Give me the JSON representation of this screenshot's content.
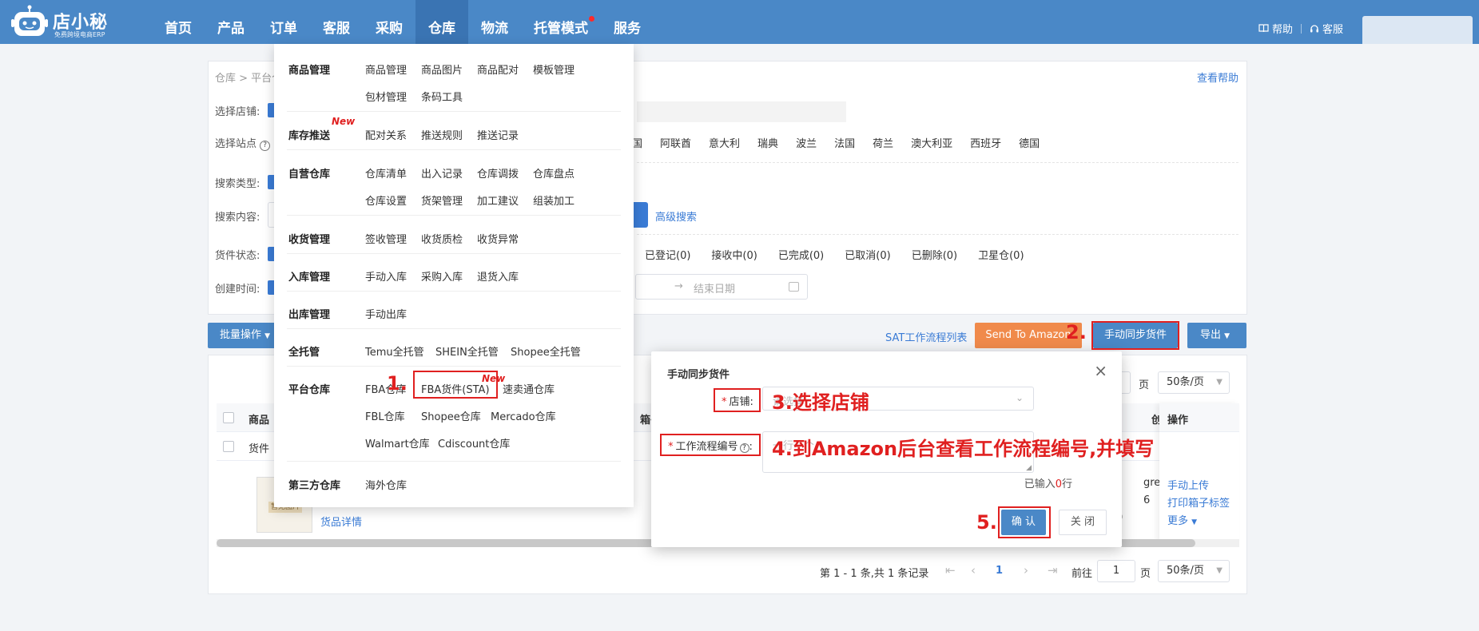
{
  "brand": {
    "name": "店小秘",
    "tagline": "免费跨境电商ERP"
  },
  "nav": {
    "items": [
      "首页",
      "产品",
      "订单",
      "客服",
      "采购",
      "仓库",
      "物流",
      "托管模式",
      "服务"
    ],
    "active_index": 5
  },
  "topright": {
    "help": "帮助",
    "service": "客服"
  },
  "breadcrumb": "仓库 > 平台仓",
  "help_link": "查看帮助",
  "filters": {
    "shop_label": "选择店铺:",
    "site_label": "选择站点",
    "search_type_label": "搜索类型:",
    "search_content_label": "搜索内容:",
    "status_label": "货件状态:",
    "created_label": "创建时间:",
    "sites": [
      "国",
      "阿联酋",
      "意大利",
      "瑞典",
      "波兰",
      "法国",
      "荷兰",
      "澳大利亚",
      "西班牙",
      "德国"
    ],
    "advanced": "高级搜索",
    "statuses": [
      "已登记(0)",
      "接收中(0)",
      "已完成(0)",
      "已取消(0)",
      "已删除(0)",
      "卫星仓(0)"
    ],
    "end_date_placeholder": "结束日期"
  },
  "toolbar": {
    "batch": "批量操作",
    "sat_list": "SAT工作流程列表",
    "send_to_amazon": "Send To Amazon",
    "manual_sync": "手动同步货件",
    "export": "导出"
  },
  "table": {
    "header_product": "商品",
    "header_boxes": "箱子",
    "header_created": "创建",
    "header_actions": "操作",
    "row_label": "货件",
    "no_image": "暂无图片",
    "item_detail": "货品详情",
    "cell_partial_1": "gre",
    "cell_partial_2": "6",
    "cell_partial_3": "0",
    "actions": [
      "手动上传",
      "打印箱子标签",
      "更多"
    ]
  },
  "pager_top": {
    "page_unit": "页",
    "page_size": "50条/页"
  },
  "pager_bottom": {
    "summary": "第 1 - 1 条,共 1 条记录",
    "current": "1",
    "goto_label": "前往",
    "goto_value": "1",
    "page_unit": "页",
    "page_size": "50条/页"
  },
  "dropdown": {
    "goods": {
      "title": "商品管理",
      "items": [
        "商品管理",
        "商品图片",
        "商品配对",
        "模板管理",
        "包材管理",
        "条码工具"
      ]
    },
    "push": {
      "title": "库存推送",
      "new": "New",
      "items": [
        "配对关系",
        "推送规则",
        "推送记录"
      ]
    },
    "self": {
      "title": "自营仓库",
      "items": [
        "仓库清单",
        "出入记录",
        "仓库调拨",
        "仓库盘点",
        "仓库设置",
        "货架管理",
        "加工建议",
        "组装加工"
      ]
    },
    "receive": {
      "title": "收货管理",
      "items": [
        "签收管理",
        "收货质检",
        "收货异常"
      ]
    },
    "inbound": {
      "title": "入库管理",
      "items": [
        "手动入库",
        "采购入库",
        "退货入库"
      ]
    },
    "outbound": {
      "title": "出库管理",
      "items": [
        "手动出库"
      ]
    },
    "managed": {
      "title": "全托管",
      "items": [
        "Temu全托管",
        "SHEIN全托管",
        "Shopee全托管"
      ]
    },
    "platform": {
      "title": "平台仓库",
      "new": "New",
      "items": [
        "FBA仓库",
        "FBA货件(STA)",
        "速卖通仓库",
        "FBL仓库",
        "Shopee仓库",
        "Mercado仓库",
        "Walmart仓库",
        "Cdiscount仓库"
      ]
    },
    "third": {
      "title": "第三方仓库",
      "items": [
        "海外仓库"
      ]
    }
  },
  "modal": {
    "title": "手动同步货件",
    "shop_label": "店铺:",
    "shop_placeholder": "请选择",
    "workflow_label": "工作流程编号",
    "workflow_placeholder": "一行一个",
    "count_prefix": "已输入",
    "count_value": "0",
    "count_suffix": "行",
    "ok": "确 认",
    "cancel": "关 闭"
  },
  "annotations": {
    "step1": "1.",
    "step2": "2.",
    "step3": "3.选择店铺",
    "step4": "4.到Amazon后台查看工作流程编号,并填写",
    "step5": "5."
  },
  "colors": {
    "primary": "#4a88c7",
    "link": "#3a7bd5",
    "accent_orange": "#f08a4b",
    "annotation_red": "#e02020"
  }
}
